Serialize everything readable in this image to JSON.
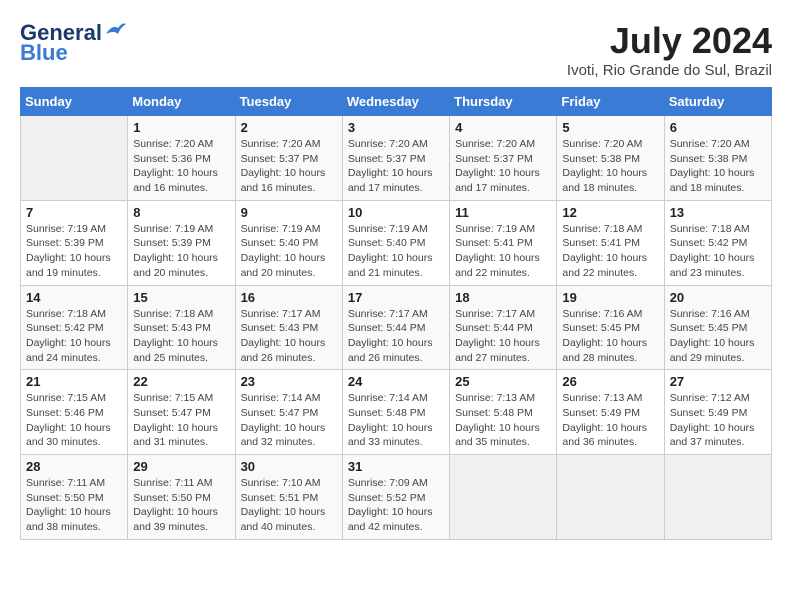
{
  "header": {
    "logo_line1": "General",
    "logo_line2": "Blue",
    "month_title": "July 2024",
    "location": "Ivoti, Rio Grande do Sul, Brazil"
  },
  "days_of_week": [
    "Sunday",
    "Monday",
    "Tuesday",
    "Wednesday",
    "Thursday",
    "Friday",
    "Saturday"
  ],
  "weeks": [
    [
      {
        "day": "",
        "info": ""
      },
      {
        "day": "1",
        "info": "Sunrise: 7:20 AM\nSunset: 5:36 PM\nDaylight: 10 hours\nand 16 minutes."
      },
      {
        "day": "2",
        "info": "Sunrise: 7:20 AM\nSunset: 5:37 PM\nDaylight: 10 hours\nand 16 minutes."
      },
      {
        "day": "3",
        "info": "Sunrise: 7:20 AM\nSunset: 5:37 PM\nDaylight: 10 hours\nand 17 minutes."
      },
      {
        "day": "4",
        "info": "Sunrise: 7:20 AM\nSunset: 5:37 PM\nDaylight: 10 hours\nand 17 minutes."
      },
      {
        "day": "5",
        "info": "Sunrise: 7:20 AM\nSunset: 5:38 PM\nDaylight: 10 hours\nand 18 minutes."
      },
      {
        "day": "6",
        "info": "Sunrise: 7:20 AM\nSunset: 5:38 PM\nDaylight: 10 hours\nand 18 minutes."
      }
    ],
    [
      {
        "day": "7",
        "info": "Sunrise: 7:19 AM\nSunset: 5:39 PM\nDaylight: 10 hours\nand 19 minutes."
      },
      {
        "day": "8",
        "info": "Sunrise: 7:19 AM\nSunset: 5:39 PM\nDaylight: 10 hours\nand 20 minutes."
      },
      {
        "day": "9",
        "info": "Sunrise: 7:19 AM\nSunset: 5:40 PM\nDaylight: 10 hours\nand 20 minutes."
      },
      {
        "day": "10",
        "info": "Sunrise: 7:19 AM\nSunset: 5:40 PM\nDaylight: 10 hours\nand 21 minutes."
      },
      {
        "day": "11",
        "info": "Sunrise: 7:19 AM\nSunset: 5:41 PM\nDaylight: 10 hours\nand 22 minutes."
      },
      {
        "day": "12",
        "info": "Sunrise: 7:18 AM\nSunset: 5:41 PM\nDaylight: 10 hours\nand 22 minutes."
      },
      {
        "day": "13",
        "info": "Sunrise: 7:18 AM\nSunset: 5:42 PM\nDaylight: 10 hours\nand 23 minutes."
      }
    ],
    [
      {
        "day": "14",
        "info": "Sunrise: 7:18 AM\nSunset: 5:42 PM\nDaylight: 10 hours\nand 24 minutes."
      },
      {
        "day": "15",
        "info": "Sunrise: 7:18 AM\nSunset: 5:43 PM\nDaylight: 10 hours\nand 25 minutes."
      },
      {
        "day": "16",
        "info": "Sunrise: 7:17 AM\nSunset: 5:43 PM\nDaylight: 10 hours\nand 26 minutes."
      },
      {
        "day": "17",
        "info": "Sunrise: 7:17 AM\nSunset: 5:44 PM\nDaylight: 10 hours\nand 26 minutes."
      },
      {
        "day": "18",
        "info": "Sunrise: 7:17 AM\nSunset: 5:44 PM\nDaylight: 10 hours\nand 27 minutes."
      },
      {
        "day": "19",
        "info": "Sunrise: 7:16 AM\nSunset: 5:45 PM\nDaylight: 10 hours\nand 28 minutes."
      },
      {
        "day": "20",
        "info": "Sunrise: 7:16 AM\nSunset: 5:45 PM\nDaylight: 10 hours\nand 29 minutes."
      }
    ],
    [
      {
        "day": "21",
        "info": "Sunrise: 7:15 AM\nSunset: 5:46 PM\nDaylight: 10 hours\nand 30 minutes."
      },
      {
        "day": "22",
        "info": "Sunrise: 7:15 AM\nSunset: 5:47 PM\nDaylight: 10 hours\nand 31 minutes."
      },
      {
        "day": "23",
        "info": "Sunrise: 7:14 AM\nSunset: 5:47 PM\nDaylight: 10 hours\nand 32 minutes."
      },
      {
        "day": "24",
        "info": "Sunrise: 7:14 AM\nSunset: 5:48 PM\nDaylight: 10 hours\nand 33 minutes."
      },
      {
        "day": "25",
        "info": "Sunrise: 7:13 AM\nSunset: 5:48 PM\nDaylight: 10 hours\nand 35 minutes."
      },
      {
        "day": "26",
        "info": "Sunrise: 7:13 AM\nSunset: 5:49 PM\nDaylight: 10 hours\nand 36 minutes."
      },
      {
        "day": "27",
        "info": "Sunrise: 7:12 AM\nSunset: 5:49 PM\nDaylight: 10 hours\nand 37 minutes."
      }
    ],
    [
      {
        "day": "28",
        "info": "Sunrise: 7:11 AM\nSunset: 5:50 PM\nDaylight: 10 hours\nand 38 minutes."
      },
      {
        "day": "29",
        "info": "Sunrise: 7:11 AM\nSunset: 5:50 PM\nDaylight: 10 hours\nand 39 minutes."
      },
      {
        "day": "30",
        "info": "Sunrise: 7:10 AM\nSunset: 5:51 PM\nDaylight: 10 hours\nand 40 minutes."
      },
      {
        "day": "31",
        "info": "Sunrise: 7:09 AM\nSunset: 5:52 PM\nDaylight: 10 hours\nand 42 minutes."
      },
      {
        "day": "",
        "info": ""
      },
      {
        "day": "",
        "info": ""
      },
      {
        "day": "",
        "info": ""
      }
    ]
  ]
}
